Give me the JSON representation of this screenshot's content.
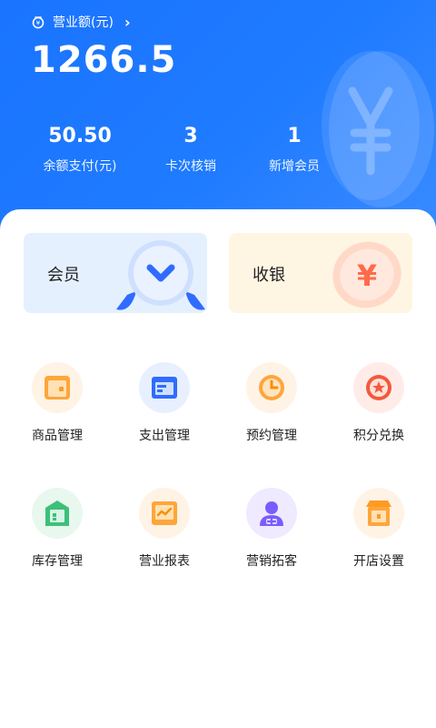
{
  "header": {
    "revenue_label": "营业额(元)",
    "revenue_chevron": "›",
    "revenue_value": "1266.5",
    "stats": [
      {
        "value": "50.50",
        "label": "余额支付(元)"
      },
      {
        "value": "3",
        "label": "卡次核销"
      },
      {
        "value": "1",
        "label": "新增会员"
      }
    ]
  },
  "cards": {
    "member": {
      "label": "会员",
      "icon": "member-chevron-icon"
    },
    "cashier": {
      "label": "收银",
      "icon": "yen-icon",
      "glyph": "¥"
    }
  },
  "grid": {
    "row1": [
      {
        "label": "商品管理",
        "icon": "goods-box-icon"
      },
      {
        "label": "支出管理",
        "icon": "expense-card-icon"
      },
      {
        "label": "预约管理",
        "icon": "clock-icon"
      },
      {
        "label": "积分兑换",
        "icon": "star-medal-icon"
      }
    ],
    "row2": [
      {
        "label": "库存管理",
        "icon": "warehouse-icon"
      },
      {
        "label": "营业报表",
        "icon": "report-chart-icon"
      },
      {
        "label": "营销拓客",
        "icon": "user-add-icon"
      },
      {
        "label": "开店设置",
        "icon": "store-icon"
      }
    ]
  },
  "colors": {
    "header_blue": "#1a74ff",
    "orange": "#ff9b21",
    "blue": "#2f6cff",
    "green": "#3cc07a",
    "purple": "#7a5cff",
    "red": "#f25a3c"
  }
}
